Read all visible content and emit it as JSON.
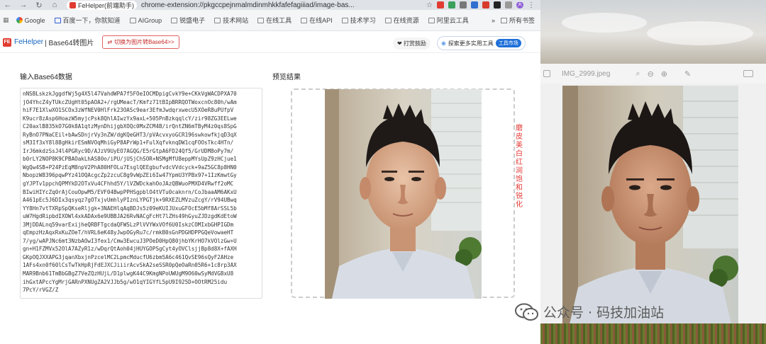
{
  "browser": {
    "tab_title": "FeHelper(前端助手)",
    "url": "chrome-extension://pkgccpejnmalmdinmhkkfafefagiiiad/image-bas...",
    "profile_initial": "天"
  },
  "bookmarks": {
    "items": [
      {
        "label": "Google"
      },
      {
        "label": "百度一下，你就知道"
      },
      {
        "label": "AIGroup"
      },
      {
        "label": "锐盛电子"
      },
      {
        "label": "技术网站"
      },
      {
        "label": "在线工具"
      },
      {
        "label": "在线API"
      },
      {
        "label": "技术学习"
      },
      {
        "label": "在线资源"
      },
      {
        "label": "阿里云工具"
      }
    ],
    "overflow": "»",
    "all_bookmarks": "所有书签"
  },
  "app": {
    "logo": "FE",
    "brand": "FeHelper",
    "page_name": " | Base64转图片",
    "switch_button": "切换为图片转Base64>>",
    "donate": "打赏鼓励",
    "explore_tools": "探索更多实用工具",
    "tool_market": "工具市场"
  },
  "input_section": {
    "title": "输入Base64数据",
    "base64_text": "nNSBLskzkJggdfWj5g4X5l47VahdWPA7f5FOeIOCMDpigCvkY9e+CKkVgWACDPXA70\njO4YhcZ4yTUkcZUgHt05pAOA2+/rgUMeacT/Kmfz71tBIpBRRQOTWoxcnOc80h/wAm\nhiF7E1XlwXO1SCOx3zWfNEV0HlFrk23OASc9ear3EfmJwdqrxwecU5XOeR8uPUfpV\nK9ucr8zAsp6HoazW5myjcPsk8QhlAIwzYx9axL+505PnBzkqqlcY/zir98ZG3EELwe\nC20axlB835kO7G0k8A1qtzMynDhijgbXOQc0MxZCM4B/irQntZN6mTByM4z0qs8SpG\nRyBnO7PNaCEil+bAwSDnjrVy3nZW/dgKQeGHT3/pVAcvxyoGCR196swkowfkjqD3qX\nsM3If3xY8l88gHkirESmNVOqMhiGyP8APrWp1+FulXqfvknqDW1cqFOOsTkc4HTn/\nIrJ6mkdzSsJ4l4PGRyc9D/AJzV9UyEO7AGQG/E5rGtpA6FD24Qf5/GrUDM8oPy7m/\nb0rLY2NOP8K9CPBAOakLhAS80o/iPU/jUSjChSOR+NSMgMfU8eppMYsUpZ9zHCjue1\nWgQw4SB+P24PzEqM8npV2PhA80HFOLu7EsglQEEgbufvdcVVdcyck+9aZ5GC8p8HN0\nNbopzW8396pqwPYz41OQAcgcZp2zcuC8g9vWpZEi6Iw47YpmU3YPBx97+1IzKmwtGy\ngYJPTv1ppchQPMYkD2OTxVu4CFhhd5Y/lVZWDckahOoJAzQBWuoPMXD4VRwff2oMC\nBIwiHIYcZq0rAjCouOpwM5/EVF04BwpPPHSgpblO4tVTu0caknrn/CoJbaaAM6AKxU\nA461pEc5J6DIx3qsyqz7gOTxjvUmhlyPIznLYPGTjk+9RXEZLMVzuZcgY/rV94UBwq\nYY8Hn7vtTXRpSpQKseRljgk+3NAEHlqAqBDJs5z09eKUIJUxuGFOcE5bMf8ArSSL5b\nuW7HgdRipbdIXOWl4xkADAx6e9UBBJA26RvNACgFcHt7lZHs49hGyuZJDzgdKdEtoW\n3MjDDALnq59varExijheQRBFTgcdaQFWSLzPlVVYWxVOf6U0IskzCOMIxbGHPIGDm\nqEmpzHzAqxRxKuZOeT/hVRL6eK48yJwpOGyRu7c/rmkB0sGnPDGHDPPGQeVowaeHT\n7/yg/wAPJNc6mt3NzbAOwI3fex1/Cmw3EwcuJ3POeD0HpQ80jhbYKrHO7kVOlzGw+U\ngn+H1FZMVx52OlA7AZyR1z/wDqrQtAoh04jHUYGOPSgCyt4yOVClsjjBp8d8X+fAXH\nGKpOQJXXAPG3jqanXbxjnPzcelMC2LpmcMducfU6zbm5A6c461QvSE96sQyF2AHze\n1AFs4xn0f60lCsTwTkHpRjFdEJXCJiiirAcvSkA2seSSR0pQeOaRn05R6+1c8rp3AX\nMAR9Bnb61TmBbGBgZ7VeZQzHUjL/D1plwgK44C9KmgNPoUWUgM9O60wSyMdVGBxU8\nihGxtAPccYgMrjGARnPXNUgZA2VJJb5g/wO1qYIGYfL5pU9I925D+OOtRM25idu\n7PcY/rVGZ/Z"
  },
  "preview_section": {
    "title": "预览结果",
    "note": "磨皮美白红润饱和锐化"
  },
  "viewer": {
    "title": "IMG_2999.jpeg"
  },
  "watermark": {
    "text": "公众号 · 码技加油站"
  }
}
